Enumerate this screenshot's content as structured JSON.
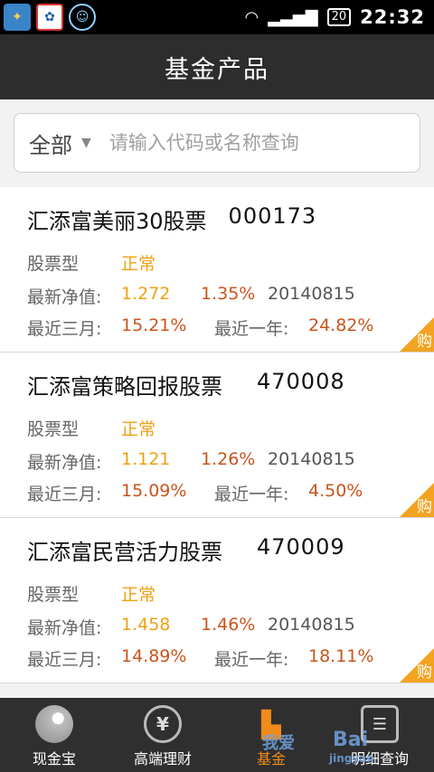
{
  "status_bar": {
    "battery": "20",
    "time": "22:32"
  },
  "header": {
    "title": "基金产品"
  },
  "search": {
    "filter_label": "全部",
    "placeholder": "请输入代码或名称查询"
  },
  "funds": [
    {
      "name": "汇添富美丽30股票",
      "code": "000173",
      "type": "股票型",
      "status": "正常",
      "nav_label": "最新净值:",
      "nav": "1.272",
      "change": "1.35%",
      "date": "20140815",
      "three_month_label": "最近三月:",
      "three_month": "15.21%",
      "one_year_label": "最近一年:",
      "one_year": "24.82%",
      "buy": "购"
    },
    {
      "name": "汇添富策略回报股票",
      "code": "470008",
      "type": "股票型",
      "status": "正常",
      "nav_label": "最新净值:",
      "nav": "1.121",
      "change": "1.26%",
      "date": "20140815",
      "three_month_label": "最近三月:",
      "three_month": "15.09%",
      "one_year_label": "最近一年:",
      "one_year": "4.50%",
      "buy": "购"
    },
    {
      "name": "汇添富民营活力股票",
      "code": "470009",
      "type": "股票型",
      "status": "正常",
      "nav_label": "最新净值:",
      "nav": "1.458",
      "change": "1.46%",
      "date": "20140815",
      "three_month_label": "最近三月:",
      "three_month": "14.89%",
      "one_year_label": "最近一年:",
      "one_year": "18.11%",
      "buy": "购"
    }
  ],
  "tabs": [
    {
      "label": "现金宝",
      "icon": "ball-icon"
    },
    {
      "label": "高端理财",
      "icon": "yen-icon"
    },
    {
      "label": "基金",
      "icon": "chart-icon",
      "active": true
    },
    {
      "label": "明细查询",
      "icon": "search-list-icon"
    }
  ],
  "watermark": {
    "text1": "我爱",
    "text2": "Bai",
    "text3": "jingyan"
  },
  "colors": {
    "accent": "#f0a012",
    "change": "#c9541c",
    "header": "#2d2d2d",
    "tabbar": "#2f2f2f"
  }
}
